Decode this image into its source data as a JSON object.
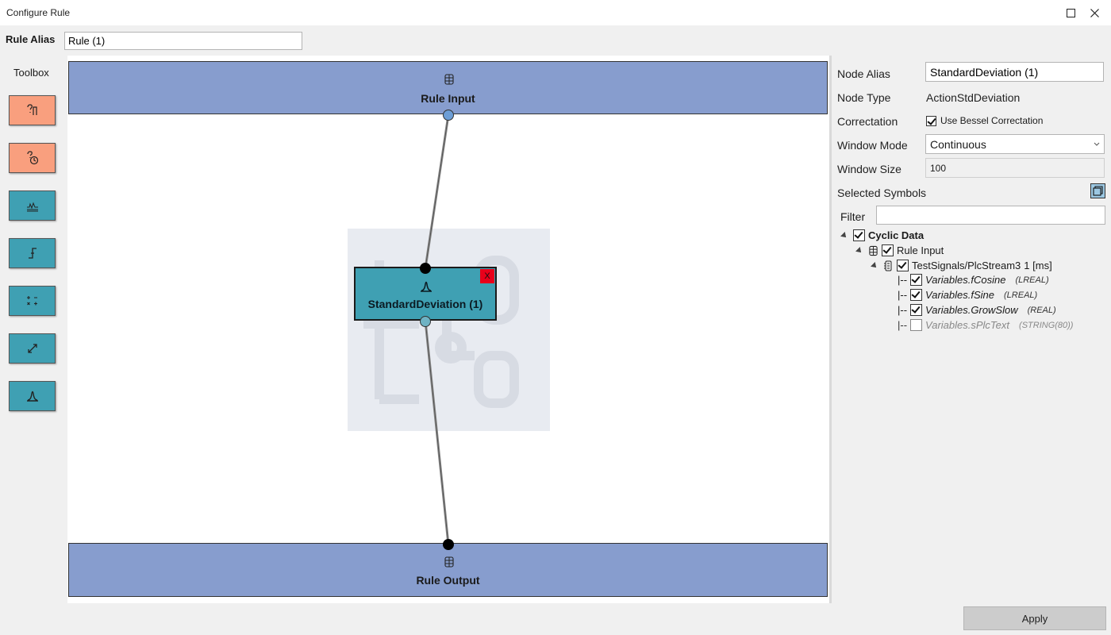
{
  "window": {
    "title": "Configure Rule"
  },
  "alias": {
    "label": "Rule Alias",
    "value": "Rule (1)"
  },
  "toolbox": {
    "title": "Toolbox",
    "tools": [
      {
        "icon": "signal-query-icon",
        "color": "#f99f7e"
      },
      {
        "icon": "trigger-query-icon",
        "color": "#f99f7e"
      },
      {
        "icon": "filter-icon",
        "color": "#3fa0b3"
      },
      {
        "icon": "edge-detect-icon",
        "color": "#3fa0b3"
      },
      {
        "icon": "math-operations-icon",
        "color": "#3fa0b3"
      },
      {
        "icon": "scale-icon",
        "color": "#3fa0b3"
      },
      {
        "icon": "std-deviation-icon",
        "color": "#3fa0b3"
      }
    ]
  },
  "canvas": {
    "input_label": "Rule Input",
    "output_label": "Rule Output",
    "node_label": "StandardDeviation (1)",
    "node_close": "X"
  },
  "properties": {
    "node_alias_label": "Node Alias",
    "node_alias_value": "StandardDeviation (1)",
    "node_type_label": "Node Type",
    "node_type_value": "ActionStdDeviation",
    "correctation_label": "Correctation",
    "bessel_label": "Use Bessel Correctation",
    "window_mode_label": "Window Mode",
    "window_mode_value": "Continuous",
    "window_size_label": "Window Size",
    "window_size_value": "100",
    "selected_symbols_label": "Selected Symbols",
    "filter_label": "Filter",
    "filter_value": ""
  },
  "tree": {
    "root": "Cyclic Data",
    "input": "Rule Input",
    "stream": "TestSignals/PlcStream3",
    "stream_rate": "1 [ms]",
    "variables": [
      {
        "prefix": "|--",
        "name": "Variables.fCosine",
        "type": "(LREAL)",
        "checked": true
      },
      {
        "prefix": "|--",
        "name": "Variables.fSine",
        "type": "(LREAL)",
        "checked": true
      },
      {
        "prefix": "|--",
        "name": "Variables.GrowSlow",
        "type": "(REAL)",
        "checked": true
      },
      {
        "prefix": "|--",
        "name": "Variables.sPlcText",
        "type": "(STRING(80))",
        "checked": false
      }
    ]
  },
  "footer": {
    "apply_label": "Apply"
  }
}
